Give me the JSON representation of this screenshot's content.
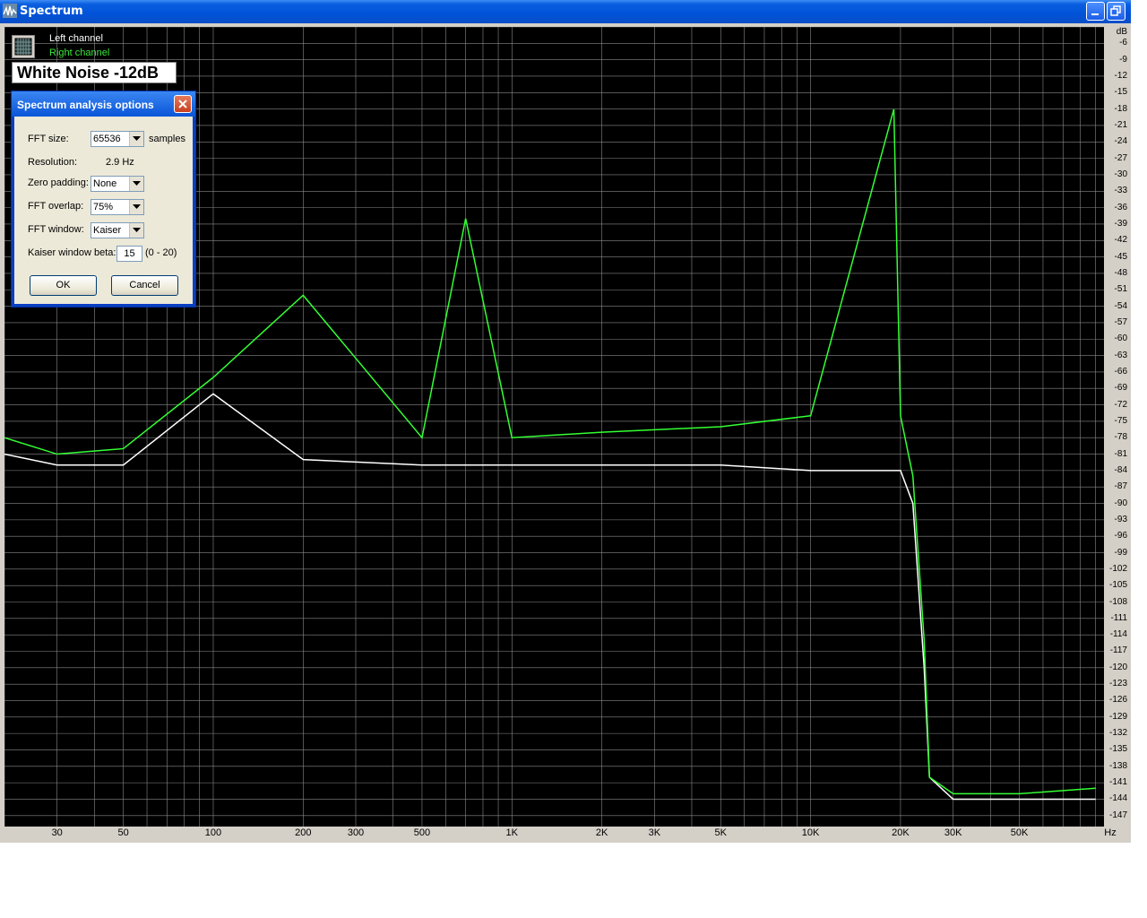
{
  "window": {
    "title": "Spectrum"
  },
  "legend": {
    "left_channel": "Left channel",
    "right_channel": "Right channel"
  },
  "plot_label": "White Noise -12dB",
  "y_axis": {
    "unit": "dB",
    "ticks": [
      "-6",
      "-9",
      "-12",
      "-15",
      "-18",
      "-21",
      "-24",
      "-27",
      "-30",
      "-33",
      "-36",
      "-39",
      "-42",
      "-45",
      "-48",
      "-51",
      "-54",
      "-57",
      "-60",
      "-63",
      "-66",
      "-69",
      "-72",
      "-75",
      "-78",
      "-81",
      "-84",
      "-87",
      "-90",
      "-93",
      "-96",
      "-99",
      "-102",
      "-105",
      "-108",
      "-111",
      "-114",
      "-117",
      "-120",
      "-123",
      "-126",
      "-129",
      "-132",
      "-135",
      "-138",
      "-141",
      "-144",
      "-147"
    ]
  },
  "x_axis": {
    "unit": "Hz",
    "ticks": [
      {
        "label": "30",
        "hz": 30
      },
      {
        "label": "50",
        "hz": 50
      },
      {
        "label": "100",
        "hz": 100
      },
      {
        "label": "200",
        "hz": 200
      },
      {
        "label": "300",
        "hz": 300
      },
      {
        "label": "500",
        "hz": 500
      },
      {
        "label": "1K",
        "hz": 1000
      },
      {
        "label": "2K",
        "hz": 2000
      },
      {
        "label": "3K",
        "hz": 3000
      },
      {
        "label": "5K",
        "hz": 5000
      },
      {
        "label": "10K",
        "hz": 10000
      },
      {
        "label": "20K",
        "hz": 20000
      },
      {
        "label": "30K",
        "hz": 30000
      },
      {
        "label": "50K",
        "hz": 50000
      }
    ]
  },
  "dialog": {
    "title": "Spectrum analysis options",
    "fft_size_label": "FFT size:",
    "fft_size_value": "65536",
    "fft_size_unit": "samples",
    "resolution_label": "Resolution:",
    "resolution_value": "2.9 Hz",
    "zero_padding_label": "Zero padding:",
    "zero_padding_value": "None",
    "fft_overlap_label": "FFT overlap:",
    "fft_overlap_value": "75%",
    "fft_window_label": "FFT window:",
    "fft_window_value": "Kaiser",
    "kaiser_beta_label": "Kaiser window beta:",
    "kaiser_beta_value": "15",
    "kaiser_beta_range": "(0 - 20)",
    "ok_label": "OK",
    "cancel_label": "Cancel"
  },
  "colors": {
    "left_channel": "#ffffff",
    "right_channel": "#33ff33",
    "grid": "#8a8a8a",
    "background": "#000000"
  },
  "chart_data": {
    "type": "line",
    "title": "White Noise -12dB",
    "xlabel": "Hz",
    "ylabel": "dB",
    "xscale": "log",
    "xlim": [
      20,
      96000
    ],
    "ylim": [
      -149,
      -3
    ],
    "grid": true,
    "legend_position": "top-left",
    "series": [
      {
        "name": "Left channel",
        "color": "#ffffff",
        "x": [
          20,
          30,
          50,
          100,
          200,
          500,
          1000,
          2000,
          5000,
          10000,
          20000,
          22000,
          24000,
          25000,
          30000,
          50000,
          90000
        ],
        "y": [
          -81,
          -83,
          -83,
          -70,
          -82,
          -83,
          -83,
          -83,
          -83,
          -84,
          -84,
          -90,
          -120,
          -140,
          -144,
          -144,
          -144
        ]
      },
      {
        "name": "Right channel",
        "color": "#33ff33",
        "x": [
          20,
          30,
          50,
          100,
          200,
          500,
          700,
          1000,
          2000,
          5000,
          10000,
          19000,
          20000,
          22000,
          24000,
          25000,
          30000,
          50000,
          90000
        ],
        "y": [
          -78,
          -81,
          -80,
          -67,
          -52,
          -78,
          -38,
          -78,
          -77,
          -76,
          -74,
          -18,
          -74,
          -85,
          -115,
          -140,
          -143,
          -143,
          -142
        ]
      }
    ]
  }
}
